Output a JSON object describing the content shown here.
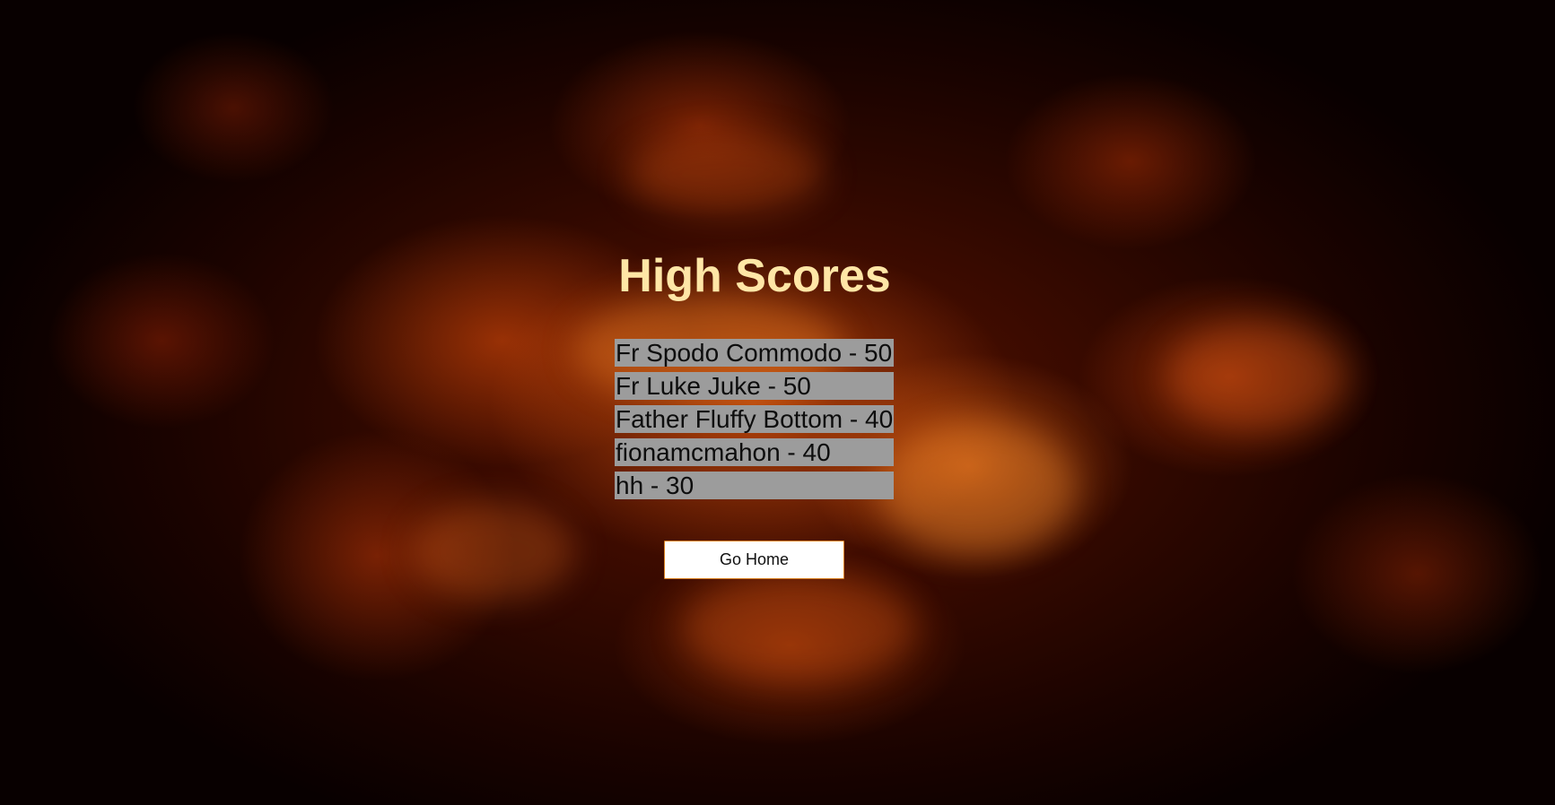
{
  "page": {
    "title": "High Scores"
  },
  "scores": [
    "Fr Spodo Commodo - 50",
    "Fr Luke Juke - 50",
    "Father Fluffy Bottom - 40",
    "fionamcmahon - 40",
    "hh - 30"
  ],
  "actions": {
    "go_home_label": "Go Home"
  },
  "colors": {
    "title": "#ffe6a6",
    "score_row_background": "#9c9c9c",
    "score_text": "#0d0d0d",
    "button_background": "#ffffff",
    "button_border": "#d8801e",
    "background_fire": "#e0560f",
    "background_dark": "#0a0100"
  },
  "background": {
    "icon": "fire-smoke-background"
  }
}
